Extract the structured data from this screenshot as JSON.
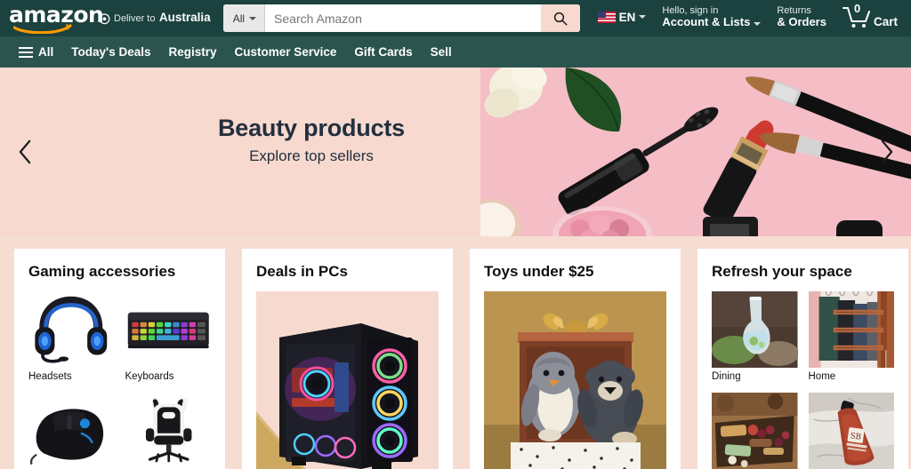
{
  "header": {
    "logo_text": "amazon",
    "logo_icon": "amazon-smile-logo",
    "deliver_to": {
      "line1": "Deliver to",
      "line2": "Australia",
      "icon": "location-pin-icon"
    },
    "search": {
      "category": "All",
      "category_icon": "chevron-down-icon",
      "placeholder": "Search Amazon",
      "value": "",
      "button_icon": "search-icon",
      "button_color": "#f7d9cf"
    },
    "language": {
      "label": "EN",
      "flag_icon": "us-flag-icon",
      "caret_icon": "chevron-down-icon"
    },
    "account": {
      "line1": "Hello, sign in",
      "line2": "Account & Lists",
      "caret_icon": "chevron-down-icon"
    },
    "returns": {
      "line1": "Returns",
      "line2": "& Orders"
    },
    "cart": {
      "count": "0",
      "label": "Cart",
      "icon": "shopping-cart-icon"
    },
    "colors": {
      "topbar_bg": "#1b423e",
      "navbar_bg": "#2c544f"
    }
  },
  "nav": {
    "all_label": "All",
    "all_icon": "hamburger-menu-icon",
    "items": [
      {
        "label": "Today's Deals"
      },
      {
        "label": "Registry"
      },
      {
        "label": "Customer Service"
      },
      {
        "label": "Gift Cards"
      },
      {
        "label": "Sell"
      }
    ]
  },
  "hero": {
    "title": "Beauty products",
    "subtitle": "Explore top sellers",
    "bg_color": "#f7d9cf",
    "prev_icon": "chevron-left-icon",
    "next_icon": "chevron-right-icon",
    "image_alt": "beauty-flatlay-mascara-lipstick-brushes"
  },
  "cards": [
    {
      "title": "Gaming accessories",
      "layout": "quad",
      "tiles": [
        {
          "label": "Headsets",
          "image_alt": "gaming-headset-blue-black"
        },
        {
          "label": "Keyboards",
          "image_alt": "rgb-gaming-keyboard"
        },
        {
          "label": "",
          "image_alt": "gaming-mouse-black"
        },
        {
          "label": "",
          "image_alt": "gaming-chair-white-black"
        }
      ]
    },
    {
      "title": "Deals in PCs",
      "layout": "single",
      "tiles": [
        {
          "label": "",
          "image_alt": "rgb-gaming-pc-tower"
        }
      ]
    },
    {
      "title": "Toys under $25",
      "layout": "single",
      "tiles": [
        {
          "label": "",
          "image_alt": "plush-penguin-bear-gift-box"
        }
      ]
    },
    {
      "title": "Refresh your space",
      "layout": "quad",
      "tiles": [
        {
          "label": "Dining",
          "image_alt": "water-carafe-dining-table"
        },
        {
          "label": "Home",
          "image_alt": "folded-textiles-home"
        },
        {
          "label": "",
          "image_alt": "charcuterie-board-snacks"
        },
        {
          "label": "",
          "image_alt": "soap-bottle-marble"
        }
      ]
    }
  ]
}
